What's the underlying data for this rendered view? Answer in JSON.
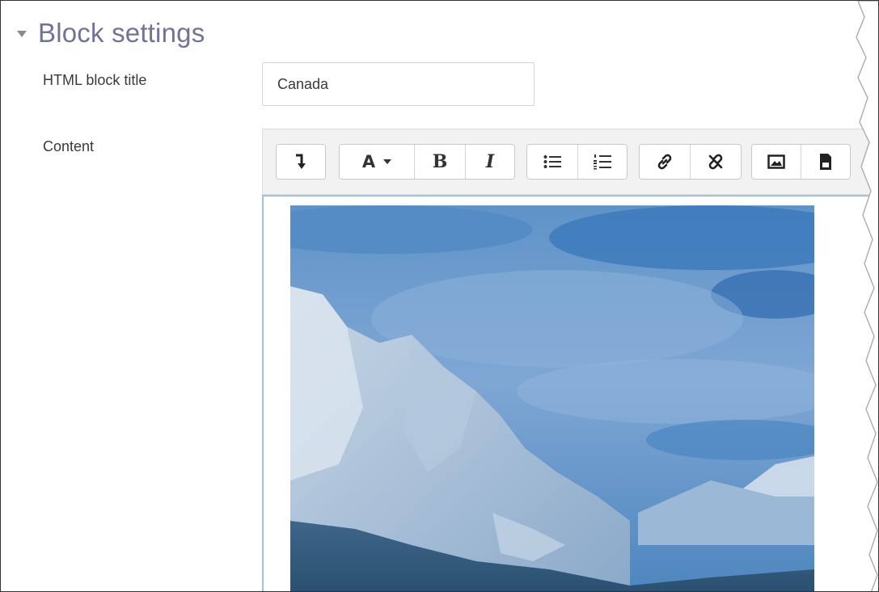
{
  "section": {
    "title": "Block settings",
    "expanded": true
  },
  "form": {
    "title_label": "HTML block title",
    "title_value": "Canada",
    "content_label": "Content"
  },
  "toolbar": {
    "buttons": [
      {
        "name": "show-more-buttons",
        "icon": "arrow-down-icon",
        "tooltip": "Show more buttons"
      },
      {
        "name": "font-style",
        "icon": "font-A-dropdown-icon",
        "text": "A"
      },
      {
        "name": "bold",
        "icon": "bold-icon",
        "text": "B"
      },
      {
        "name": "italic",
        "icon": "italic-icon",
        "text": "I"
      },
      {
        "name": "unordered-list",
        "icon": "unordered-list-icon"
      },
      {
        "name": "ordered-list",
        "icon": "ordered-list-icon"
      },
      {
        "name": "link",
        "icon": "link-icon"
      },
      {
        "name": "unlink",
        "icon": "unlink-icon"
      },
      {
        "name": "image",
        "icon": "image-icon"
      },
      {
        "name": "media",
        "icon": "file-icon"
      }
    ]
  },
  "editor": {
    "content": "image",
    "image_subject": "snow-covered mountains under cloudy sky (selected, blue tint)"
  },
  "colors": {
    "section_title": "#6f7497",
    "editor_focus_border": "#9fc1e3",
    "toolbar_bg": "#f2f2f2"
  }
}
